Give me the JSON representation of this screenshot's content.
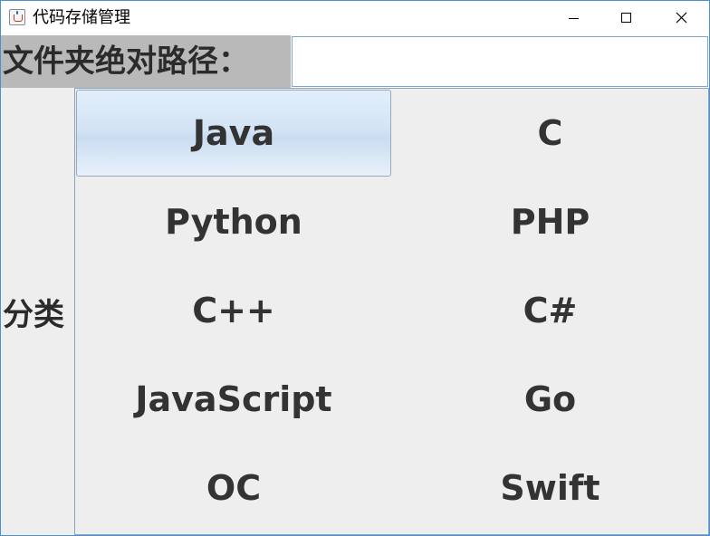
{
  "window": {
    "title": "代码存储管理",
    "icon": "java-cup-icon"
  },
  "controls": {
    "minimize_icon": "minimize-icon",
    "maximize_icon": "maximize-icon",
    "close_icon": "close-icon"
  },
  "path": {
    "label": "文件夹绝对路径：",
    "value": "",
    "placeholder": ""
  },
  "category": {
    "label": "分类",
    "selected": "Java",
    "buttons": [
      "Java",
      "C",
      "Python",
      "PHP",
      "C++",
      "C#",
      "JavaScript",
      "Go",
      "OC",
      "Swift"
    ]
  },
  "colors": {
    "path_label_bg": "#b9b9b9",
    "panel_bg": "#eeeeee",
    "text": "#333333",
    "window_border": "#4a90d9"
  }
}
